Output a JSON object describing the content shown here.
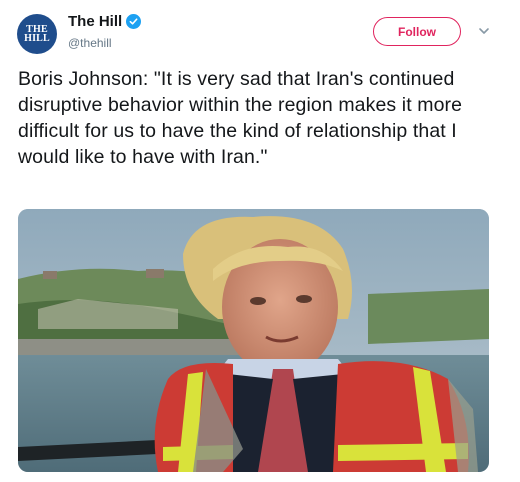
{
  "account": {
    "avatar_line1": "THE",
    "avatar_line2": "HILL",
    "name": "The Hill",
    "handle": "@thehill",
    "verified": true
  },
  "follow_label": "Follow",
  "tweet_text": "Boris Johnson: \"It is very sad that Iran's continued disruptive behavior within the region makes it more difficult for us to have the kind of relationship that I would like to have with Iran.\"",
  "colors": {
    "accent": "#e0245e",
    "verified": "#1da1f2",
    "avatar": "#1f4d8c",
    "text": "#14171a",
    "secondary_text": "#657786"
  },
  "icons": {
    "verified": "verified-badge-icon",
    "more": "chevron-down-icon"
  }
}
